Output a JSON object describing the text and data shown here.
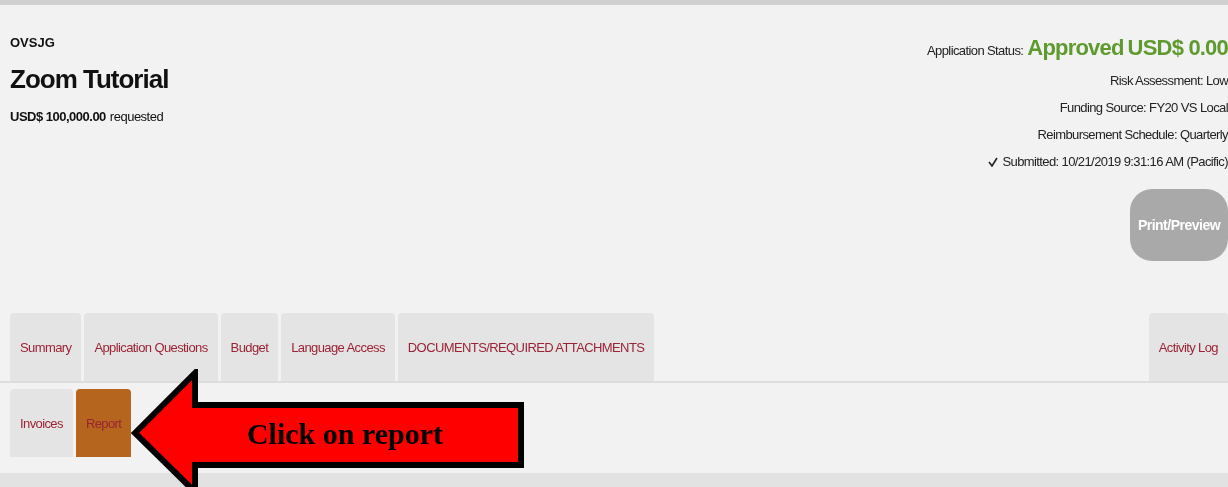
{
  "header": {
    "org": "OVSJG",
    "title": "Zoom Tutorial",
    "amount": "USD$ 100,000.00",
    "amount_note": "requested"
  },
  "status": {
    "label": "Application Status:",
    "value": "Approved",
    "amount": "USD$ 0.00",
    "lines": [
      "Risk Assessment: Low",
      "Funding Source: FY20 VS Local",
      "Reimbursement Schedule: Quarterly"
    ],
    "submitted": "Submitted: 10/21/2019 9:31:16 AM (Pacific)",
    "print_button": {
      "label": "Print/Preview",
      "disabled": true
    }
  },
  "main_tabs": [
    {
      "label": "Summary",
      "selected": false
    },
    {
      "label": "Application Questions",
      "selected": false
    },
    {
      "label": "Budget",
      "selected": false
    },
    {
      "label": "Language Access",
      "selected": false
    },
    {
      "label": "DOCUMENTS/REQUIRED ATTACHMENTS",
      "selected": false
    }
  ],
  "side_tab": {
    "label": "Activity Log",
    "selected": false
  },
  "sub_tabs": [
    {
      "label": "Invoices",
      "selected": false
    },
    {
      "label": "Report",
      "selected": true
    }
  ],
  "callout": {
    "text": "Click on report"
  }
}
